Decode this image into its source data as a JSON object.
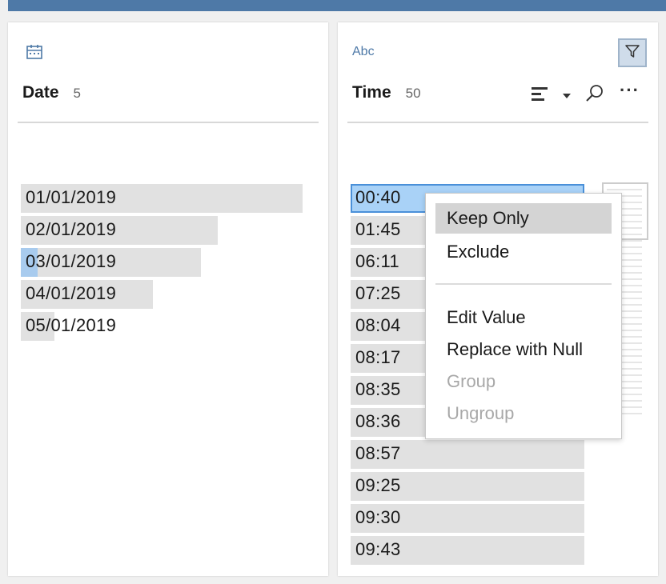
{
  "date_column": {
    "type_icon": "calendar-icon",
    "name": "Date",
    "count": "5",
    "values": [
      {
        "label": "01/01/2019",
        "proportion": 1.0,
        "highlight": 0
      },
      {
        "label": "02/01/2019",
        "proportion": 0.7,
        "highlight": 0
      },
      {
        "label": "03/01/2019",
        "proportion": 0.64,
        "highlight": 0.06
      },
      {
        "label": "04/01/2019",
        "proportion": 0.47,
        "highlight": 0
      },
      {
        "label": "05/01/2019",
        "proportion": 0.12,
        "highlight": 0
      }
    ]
  },
  "time_column": {
    "type_label": "Abc",
    "name": "Time",
    "count": "50",
    "tools": [
      "filter-icon",
      "sort-icon",
      "caret-down-icon",
      "search-icon",
      "more-icon"
    ],
    "more_label": "···",
    "values": [
      "00:40",
      "01:45",
      "06:11",
      "07:25",
      "08:04",
      "08:17",
      "08:35",
      "08:36",
      "08:57",
      "09:25",
      "09:30",
      "09:43"
    ],
    "selected_value": "00:40"
  },
  "context_menu": {
    "keep_only": "Keep Only",
    "exclude": "Exclude",
    "edit_value": "Edit Value",
    "replace_null": "Replace with Null",
    "group": "Group",
    "ungroup": "Ungroup"
  },
  "colors": {
    "accent": "#4e79a7",
    "bar": "#e1e1e1",
    "selection": "#a9d2f7",
    "selection_border": "#4a90d9"
  }
}
